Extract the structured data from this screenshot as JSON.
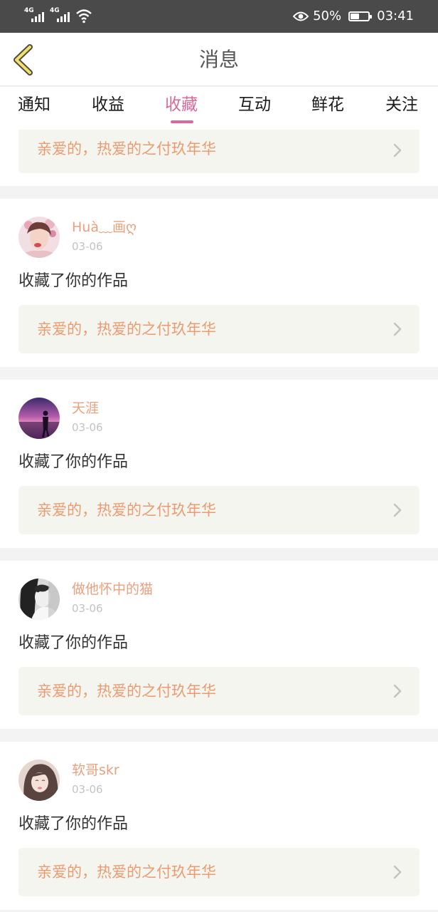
{
  "status_bar": {
    "network1": "4G",
    "network2": "4G",
    "battery_percent": "50%",
    "battery_level": 0.5,
    "time": "03:41"
  },
  "nav": {
    "title": "消息",
    "back_icon": "chevron-left-icon"
  },
  "tabs": [
    {
      "label": "通知"
    },
    {
      "label": "收益"
    },
    {
      "label": "收藏"
    },
    {
      "label": "互动"
    },
    {
      "label": "鲜花"
    },
    {
      "label": "关注"
    }
  ],
  "active_tab": "收藏",
  "colors": {
    "accent_pink": "#d9699a",
    "name_orange": "#e9a07d",
    "work_title_orange": "#ea9b70",
    "work_bg": "#f5f5ef",
    "status_bar_bg": "#4a4a4a"
  },
  "partial_card": {
    "work_title": "亲爱的，热爱的之付玖年华"
  },
  "messages": [
    {
      "user": "Huà﹏画ღ",
      "date": "03-06",
      "action": "收藏了你的作品",
      "work_title": "亲爱的，热爱的之付玖年华"
    },
    {
      "user": "天涯",
      "date": "03-06",
      "action": "收藏了你的作品",
      "work_title": "亲爱的，热爱的之付玖年华"
    },
    {
      "user": "做他怀中的猫",
      "date": "03-06",
      "action": "收藏了你的作品",
      "work_title": "亲爱的，热爱的之付玖年华"
    },
    {
      "user": "软哥skr",
      "date": "03-06",
      "action": "收藏了你的作品",
      "work_title": "亲爱的，热爱的之付玖年华"
    }
  ]
}
